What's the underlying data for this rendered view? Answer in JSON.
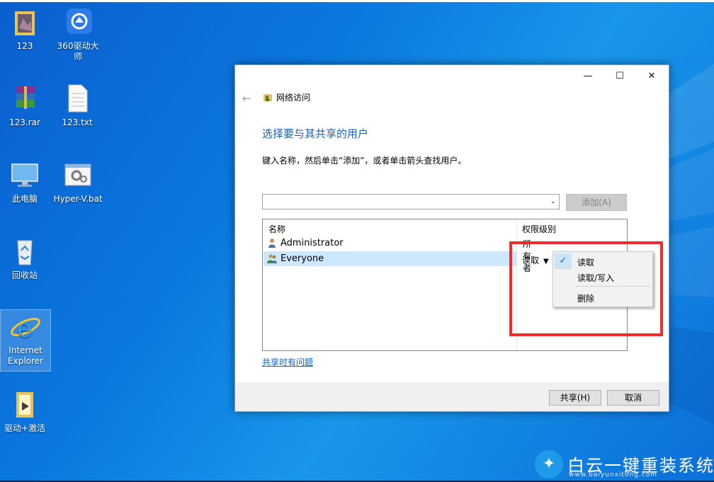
{
  "desktop": {
    "icons": [
      {
        "label": "123",
        "icon": "folder-icon"
      },
      {
        "label": "360驱动大师",
        "icon": "360-driver-icon"
      },
      {
        "label": "123.rar",
        "icon": "winrar-archive-icon"
      },
      {
        "label": "123.txt",
        "icon": "text-file-icon"
      },
      {
        "label": "此电脑",
        "icon": "computer-icon"
      },
      {
        "label": "Hyper-V.bat",
        "icon": "batch-file-icon"
      },
      {
        "label": "回收站",
        "icon": "recycle-bin-icon"
      },
      {
        "label": "Internet Explorer",
        "icon": "ie-icon"
      },
      {
        "label": "驱动+激活",
        "icon": "folder-icon"
      }
    ]
  },
  "window": {
    "nav_title": "网络访问",
    "heading": "选择要与其共享的用户",
    "instruction": "键入名称，然后单击“添加”，或者单击箭头查找用户。",
    "add_button": "添加(A)",
    "columns": {
      "name": "名称",
      "permission": "权限级别"
    },
    "users": [
      {
        "name": "Administrator",
        "permission": "所有者"
      },
      {
        "name": "Everyone",
        "permission": "读取"
      }
    ],
    "help_link": "共享时有问题",
    "share_button": "共享(H)",
    "cancel_button": "取消"
  },
  "permission_menu": {
    "items": [
      "读取",
      "读取/写入",
      "删除"
    ],
    "checked": "读取"
  },
  "watermark": {
    "text": "白云一键重装系统",
    "url": "www.baiyunxitong.com"
  },
  "colors": {
    "accent": "#1b5fb3",
    "highlight": "#ef2b2b",
    "selection": "#cce8ff"
  }
}
